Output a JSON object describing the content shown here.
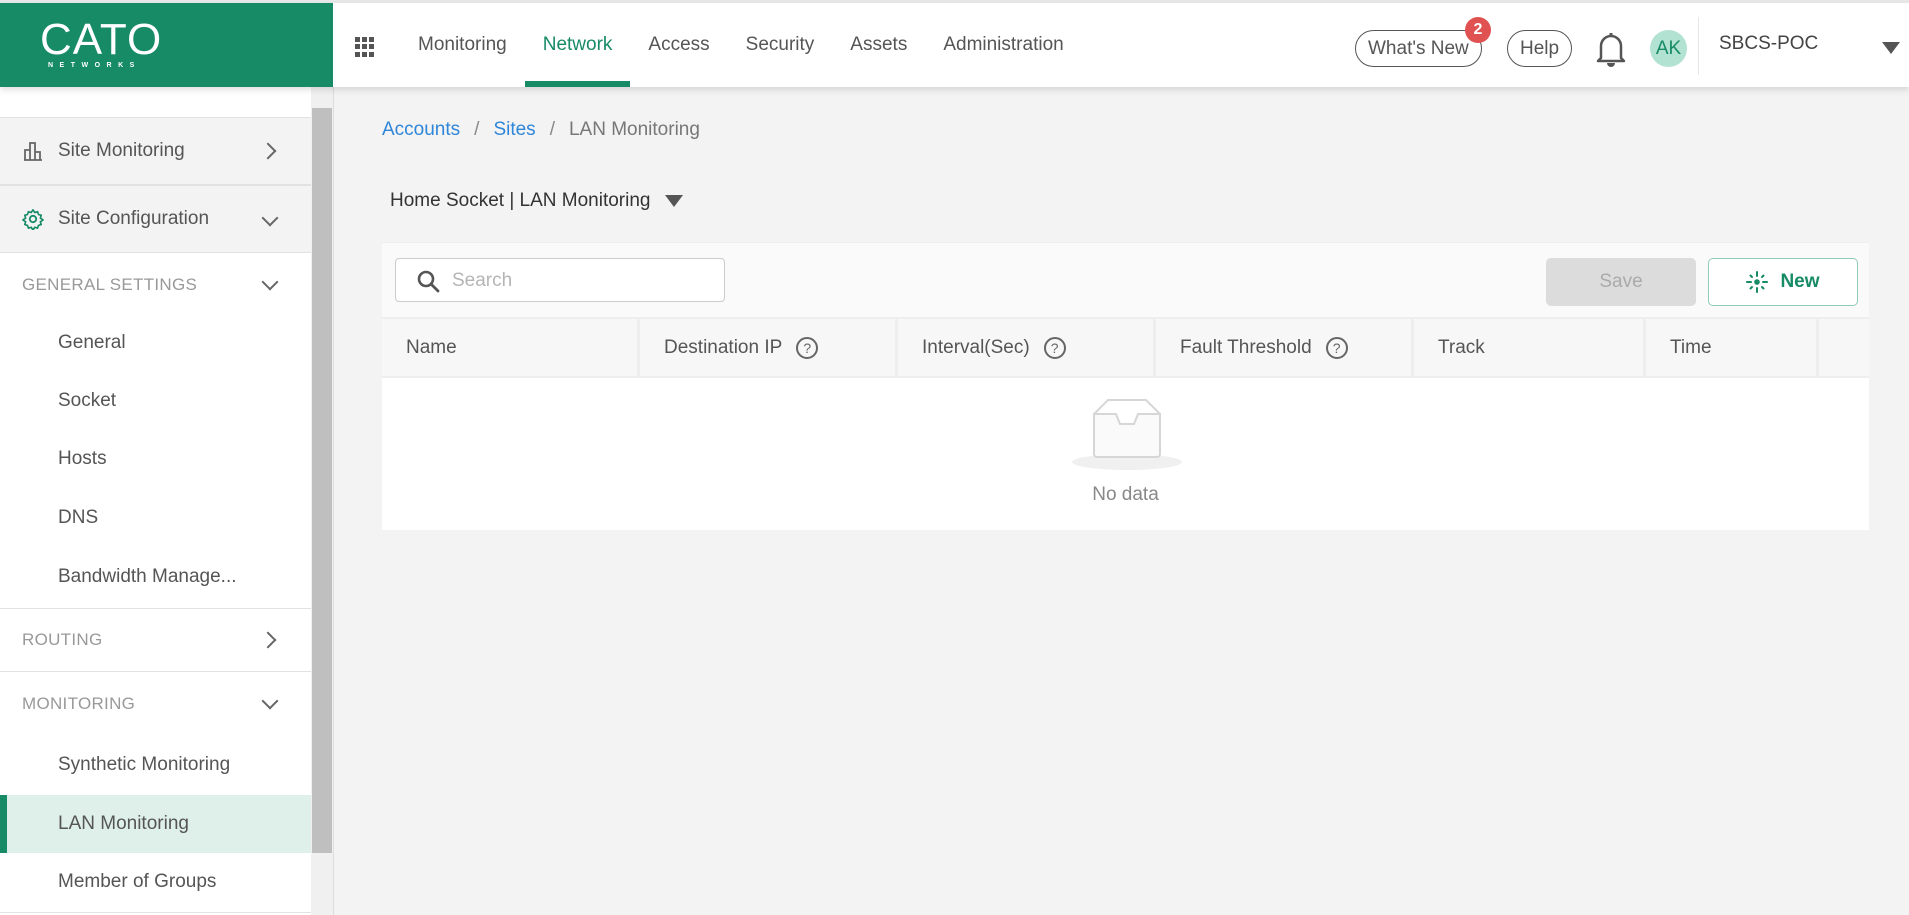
{
  "brand": {
    "name": "CATO",
    "sub": "NETWORKS",
    "color": "#178a66"
  },
  "topnav": {
    "items": [
      {
        "label": "Monitoring",
        "active": false
      },
      {
        "label": "Network",
        "active": true
      },
      {
        "label": "Access",
        "active": false
      },
      {
        "label": "Security",
        "active": false
      },
      {
        "label": "Assets",
        "active": false
      },
      {
        "label": "Administration",
        "active": false
      }
    ],
    "whats_new": "What's New",
    "whats_new_badge": "2",
    "help": "Help",
    "avatar_initials": "AK",
    "account": "SBCS-POC"
  },
  "sidebar": {
    "sections": [
      {
        "label": "Site Monitoring",
        "icon": "bar-chart-icon",
        "expanded": false
      },
      {
        "label": "Site Configuration",
        "icon": "gear-icon",
        "expanded": true
      }
    ],
    "groups": [
      {
        "label": "GENERAL SETTINGS",
        "expanded": true,
        "items": [
          "General",
          "Socket",
          "Hosts",
          "DNS",
          "Bandwidth Manage..."
        ]
      },
      {
        "label": "ROUTING",
        "expanded": false,
        "items": []
      },
      {
        "label": "MONITORING",
        "expanded": true,
        "items": [
          "Synthetic Monitoring",
          "LAN Monitoring",
          "Member of Groups"
        ]
      }
    ],
    "active_item": "LAN Monitoring"
  },
  "breadcrumb": [
    {
      "label": "Accounts",
      "link": true
    },
    {
      "label": "Sites",
      "link": true
    },
    {
      "label": "LAN Monitoring",
      "link": false
    }
  ],
  "breadcrumb_sep": "/",
  "page_title": "Home Socket | LAN Monitoring",
  "toolbar": {
    "search_placeholder": "Search",
    "search_value": "",
    "save_label": "Save",
    "new_label": "New"
  },
  "table": {
    "columns": [
      {
        "label": "Name",
        "help": false
      },
      {
        "label": "Destination IP",
        "help": true
      },
      {
        "label": "Interval(Sec)",
        "help": true
      },
      {
        "label": "Fault Threshold",
        "help": true
      },
      {
        "label": "Track",
        "help": false
      },
      {
        "label": "Time",
        "help": false
      }
    ],
    "rows": [],
    "empty_text": "No data"
  }
}
